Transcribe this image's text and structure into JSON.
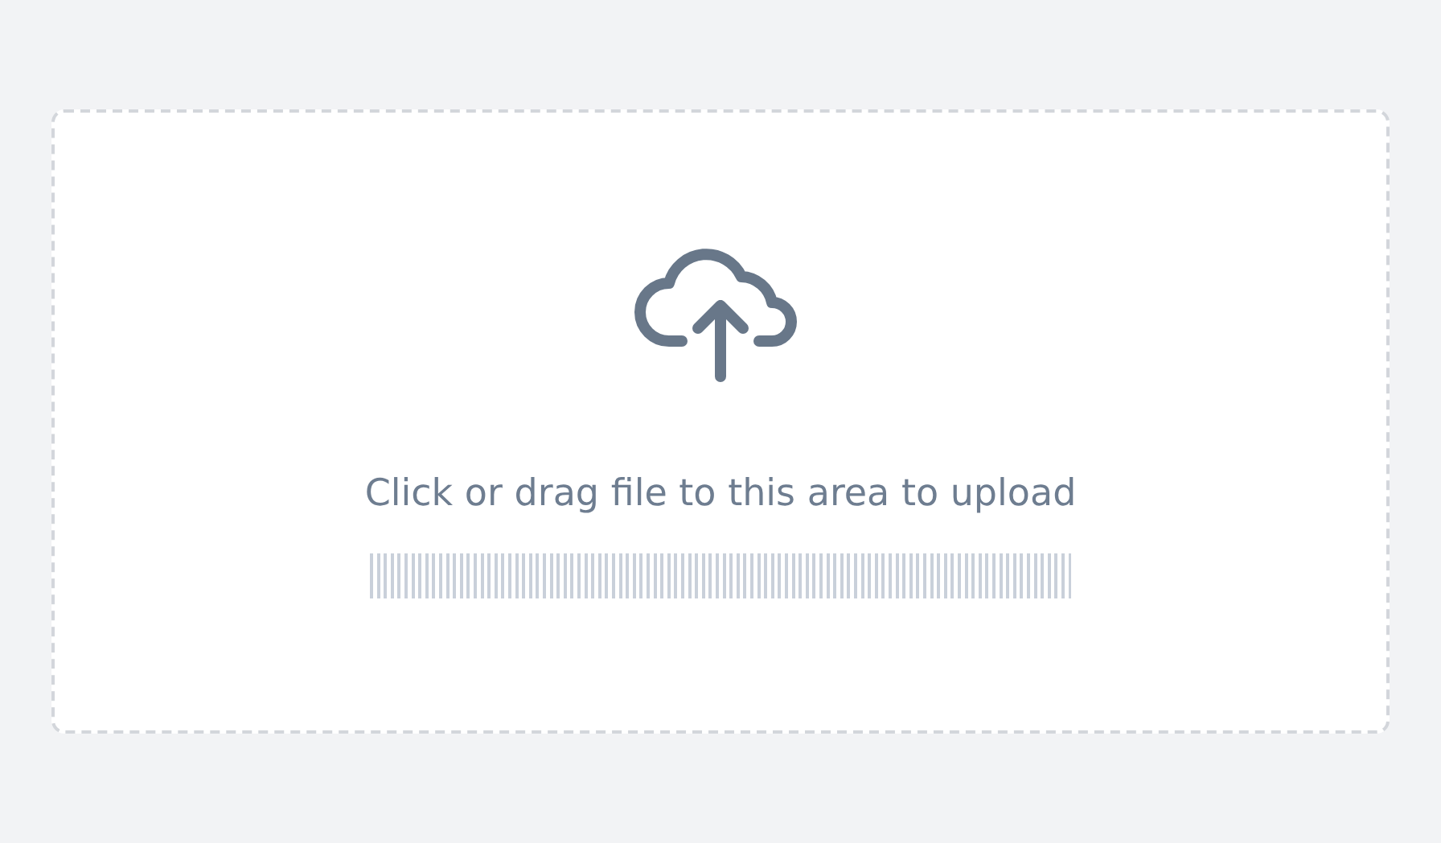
{
  "upload_area": {
    "hint": "Click or drag file to this area to upload"
  }
}
